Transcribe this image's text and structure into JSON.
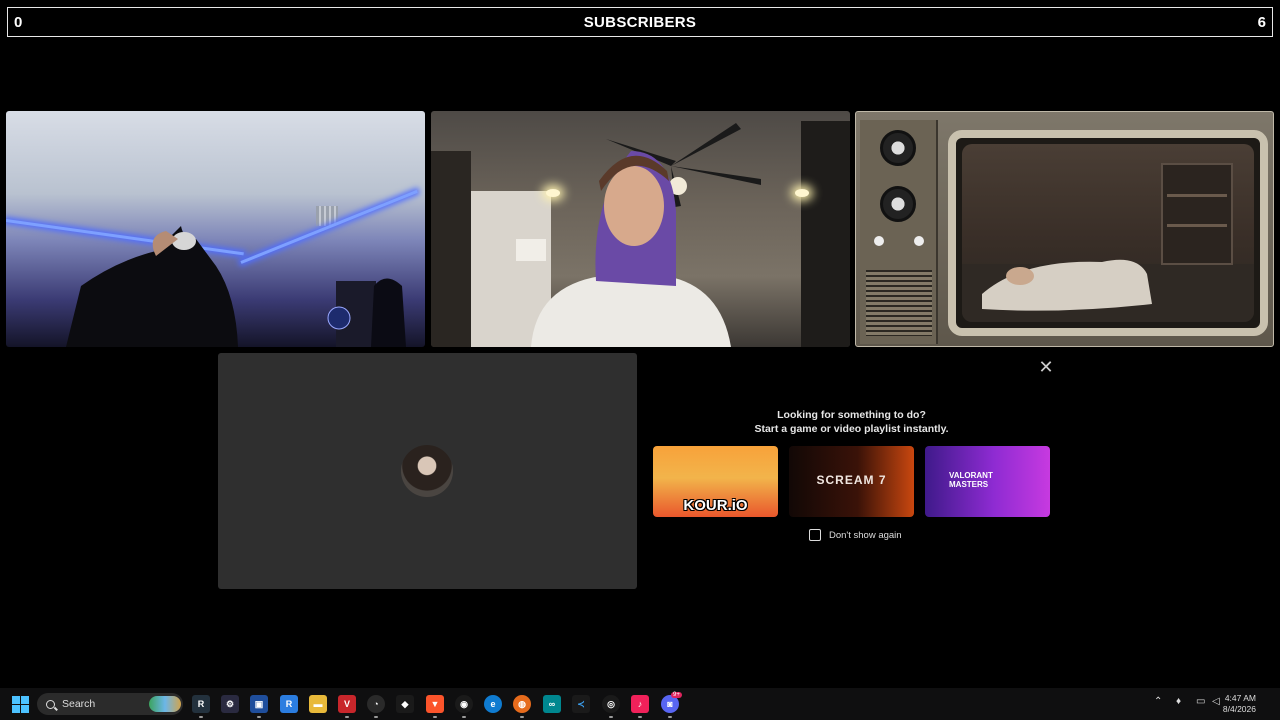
{
  "banner": {
    "left_count": "0",
    "title": "SUBSCRIBERS",
    "right_count": "6"
  },
  "activity_panel": {
    "line1": "Looking for something to do?",
    "line2": "Start a game or video playlist instantly.",
    "cards": [
      {
        "label": "KOUR.iO"
      },
      {
        "label": "SCREAM 7"
      },
      {
        "label": "VALORANT MASTERS"
      }
    ],
    "dont_show_label": "Don't show again"
  },
  "taskbar": {
    "search_label": "Search",
    "time": "4:47 AM",
    "date": "8/4/2026",
    "discord_badge": "9+"
  }
}
